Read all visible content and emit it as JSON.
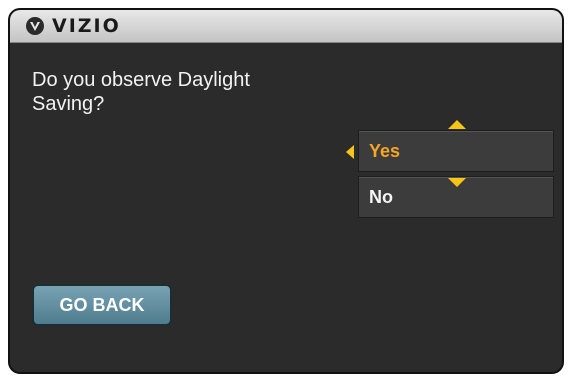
{
  "header": {
    "brand": "VIZIO",
    "logo_icon": "vizio-v-badge-icon"
  },
  "dialog": {
    "prompt": "Do you observe Daylight Saving?",
    "options": [
      {
        "label": "Yes",
        "selected": true
      },
      {
        "label": "No",
        "selected": false
      }
    ],
    "scroll_up_icon": "triangle-up-icon",
    "scroll_down_icon": "triangle-down-icon",
    "selection_indicator_icon": "triangle-left-icon"
  },
  "footer": {
    "go_back_label": "GO BACK"
  },
  "colors": {
    "background": "#2b2b2b",
    "selected_text": "#f5a623",
    "arrow": "#f5c518",
    "button": "#5f8c9d"
  }
}
